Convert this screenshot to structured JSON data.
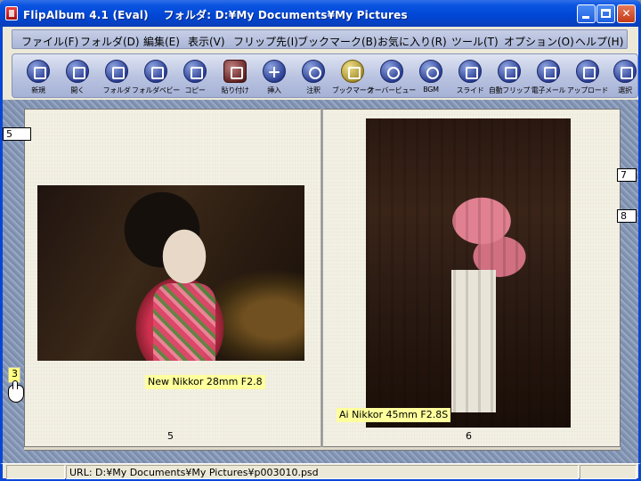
{
  "window": {
    "title": "FlipAlbum 4.1 (Eval)　 フォルダ: D:¥My Documents¥My Pictures"
  },
  "menu": [
    {
      "label": "ファイル(F)"
    },
    {
      "label": "フォルダ(D)"
    },
    {
      "label": "編集(E)"
    },
    {
      "label": "表示(V)"
    },
    {
      "label": "フリップ先(I)"
    },
    {
      "label": "ブックマーク(B)"
    },
    {
      "label": "お気に入り(R)"
    },
    {
      "label": "ツール(T)"
    },
    {
      "label": "オプション(O)"
    },
    {
      "label": "ヘルプ(H)"
    }
  ],
  "toolbar": [
    {
      "label": "新規",
      "icon": "new-icon"
    },
    {
      "label": "開く",
      "icon": "open-book-icon"
    },
    {
      "label": "フォルダ",
      "icon": "folder-icon"
    },
    {
      "label": "フォルダベビー",
      "icon": "folder-copy-icon"
    },
    {
      "label": "コピー",
      "icon": "copy-icon"
    },
    {
      "label": "貼り付け",
      "icon": "paste-icon"
    },
    {
      "label": "挿入",
      "icon": "insert-icon"
    },
    {
      "label": "注釈",
      "icon": "annotate-icon"
    },
    {
      "label": "ブックマーク",
      "icon": "bookmark-icon"
    },
    {
      "label": "オーバービュー",
      "icon": "overview-icon"
    },
    {
      "label": "BGM",
      "icon": "music-icon"
    },
    {
      "label": "スライド",
      "icon": "slide-icon"
    },
    {
      "label": "自動フリップ",
      "icon": "auto-flip-icon"
    },
    {
      "label": "電子メール",
      "icon": "email-icon"
    },
    {
      "label": "アップロード",
      "icon": "upload-icon"
    },
    {
      "label": "選択",
      "icon": "select-icon"
    }
  ],
  "album": {
    "left_tab": "5",
    "right_tabs": [
      "7",
      "8"
    ],
    "left_marker": "3",
    "left_page": {
      "number": "5",
      "caption": "New Nikkor 28mm F2.8"
    },
    "right_page": {
      "number": "6",
      "caption": "Ai Nikkor 45mm F2.8S"
    }
  },
  "status": {
    "url": "URL: D:¥My Documents¥My Pictures¥p003010.psd"
  }
}
